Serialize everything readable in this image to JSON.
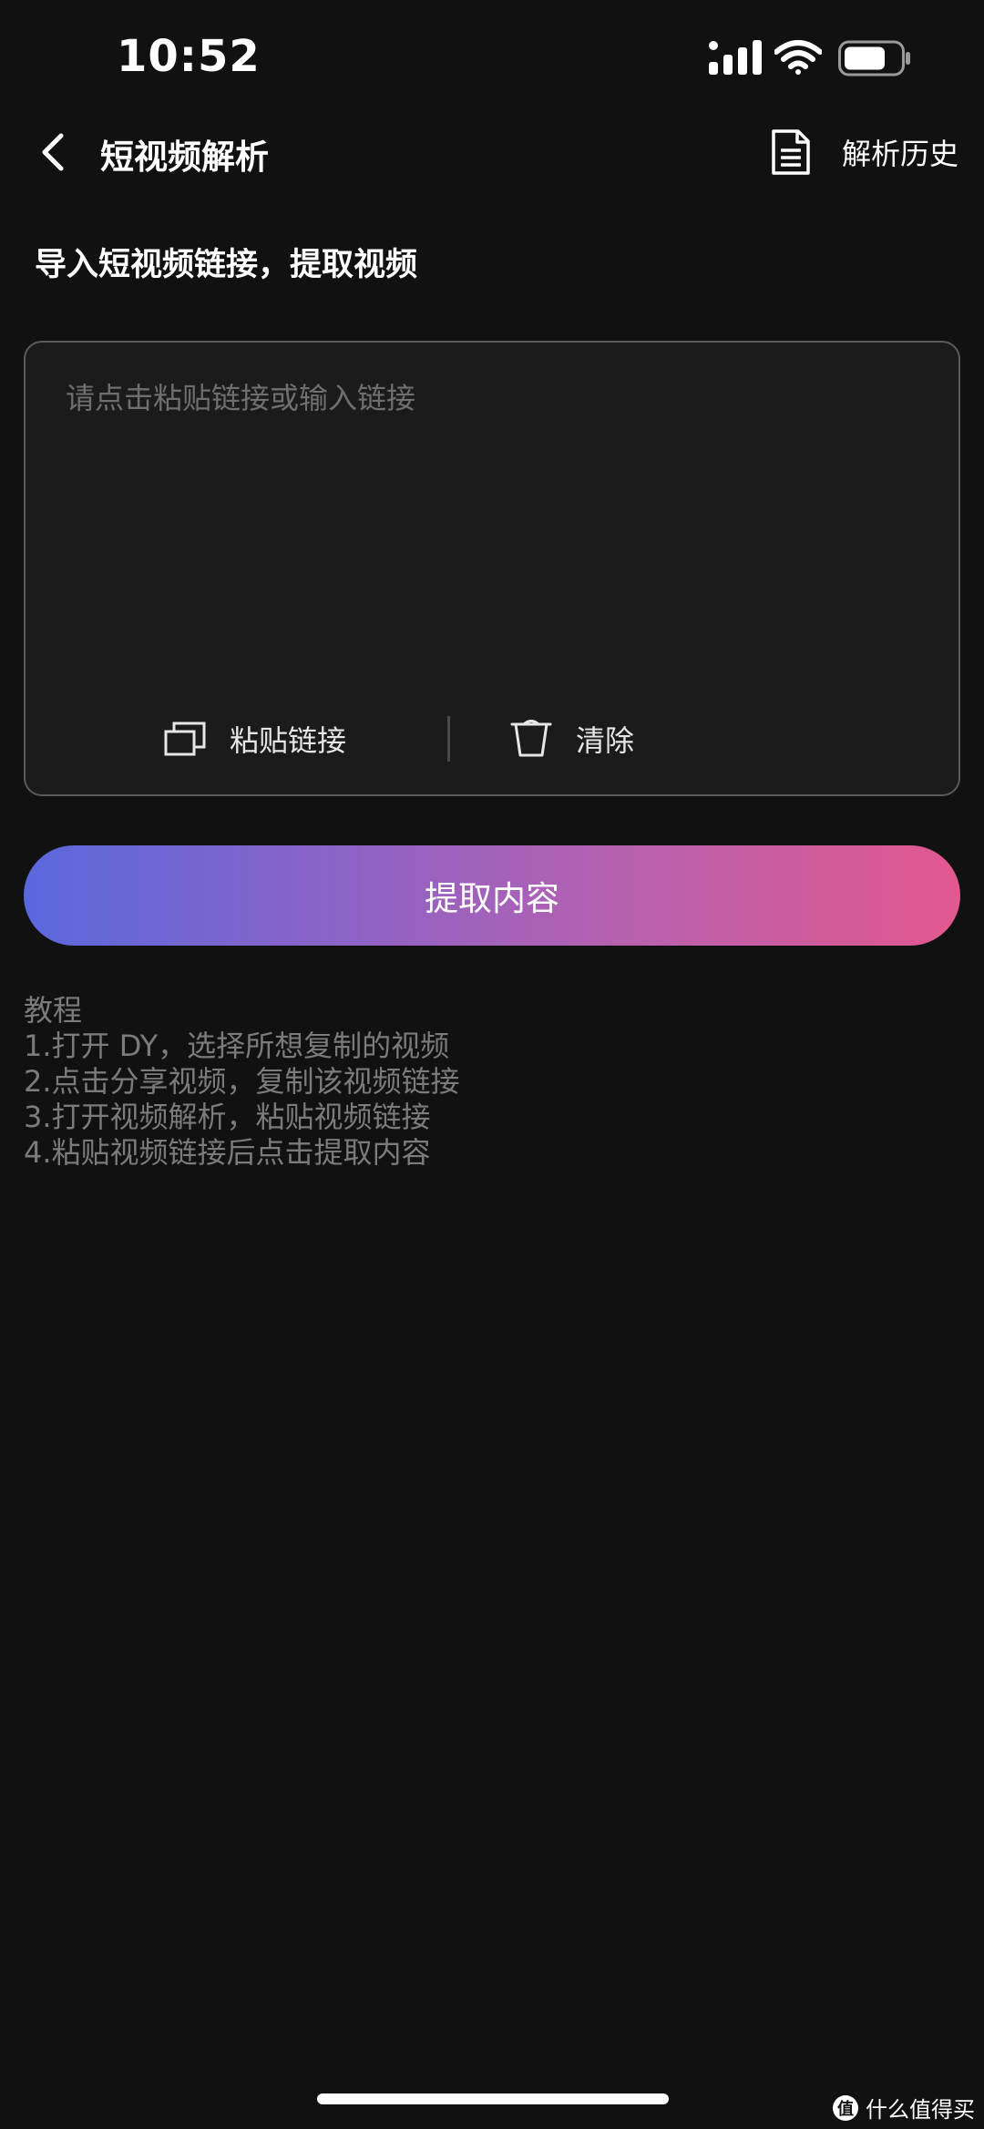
{
  "status_bar": {
    "time": "10:52"
  },
  "nav": {
    "title": "短视频解析",
    "history_label": "解析历史"
  },
  "subtitle": "导入短视频链接，提取视频",
  "input": {
    "value": "",
    "placeholder": "请点击粘贴链接或输入链接"
  },
  "actions": {
    "paste_label": "粘贴链接",
    "clear_label": "清除"
  },
  "extract_label": "提取内容",
  "tutorial": {
    "title": "教程",
    "steps": [
      "1.打开 DY，选择所想复制的视频",
      "2.点击分享视频，复制该视频链接",
      "3.打开视频解析，粘贴视频链接",
      "4.粘贴视频链接后点击提取内容"
    ]
  },
  "watermark": {
    "logo": "值",
    "text": "什么值得买"
  },
  "icons": {
    "back": "chevron-left-icon",
    "history": "document-icon",
    "paste": "copy-icon",
    "clear": "trash-icon"
  },
  "colors": {
    "background": "#111111",
    "card_border": "#5a5a5a",
    "gradient_start": "#5a68dd",
    "gradient_end": "#e2588f",
    "muted_text": "#7b7b7b"
  }
}
